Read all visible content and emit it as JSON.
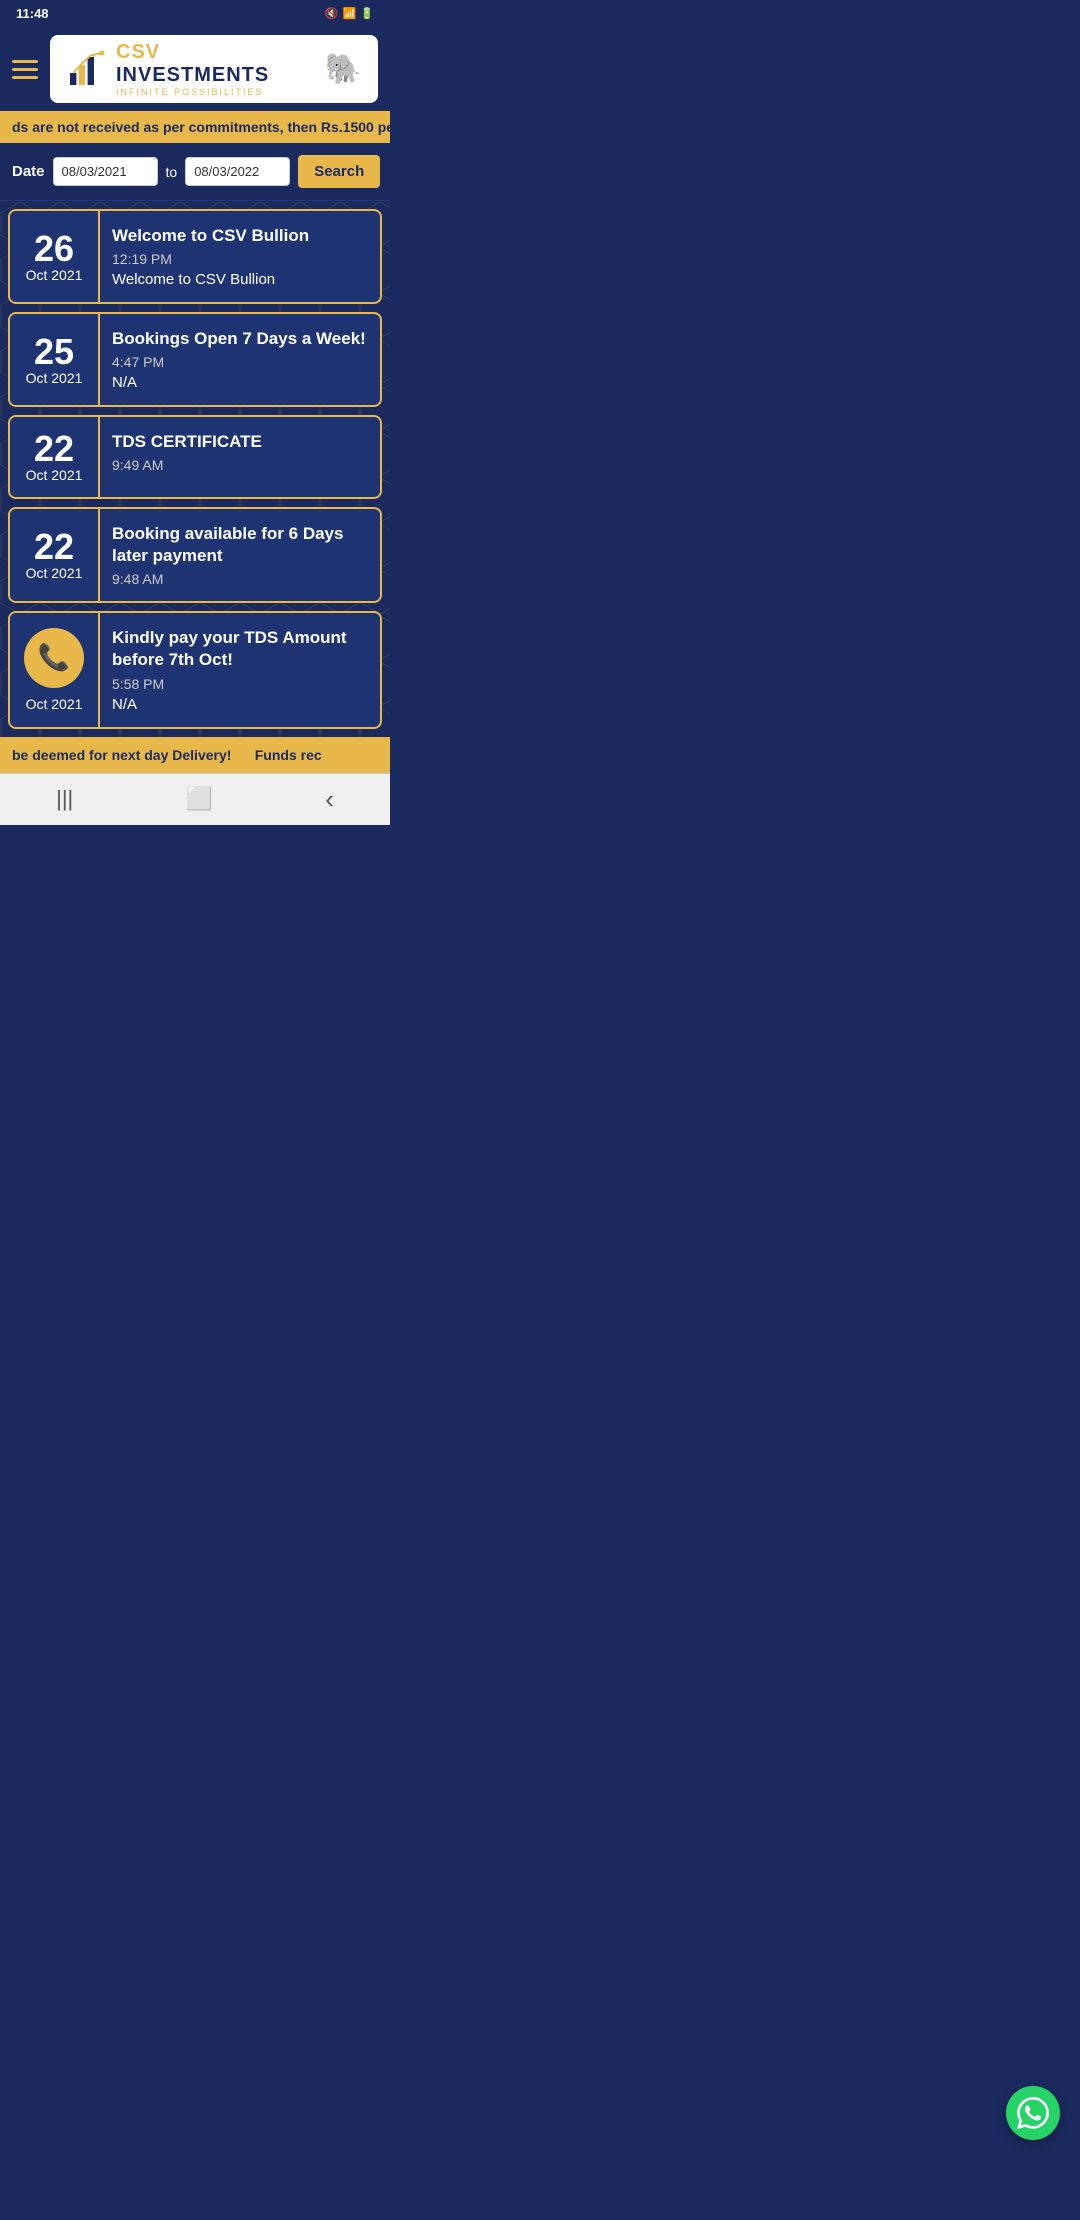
{
  "statusBar": {
    "time": "11:48",
    "icons": [
      "mute",
      "wifi",
      "signal",
      "battery"
    ]
  },
  "header": {
    "hamburgerLabel": "Menu",
    "logoTitle": "CSV INVESTMENTS",
    "logoSubtitle": "INFINITE POSSIBILITIES"
  },
  "ticker": {
    "text": "ds are not received as per commitments, then Rs.1500 pe"
  },
  "dateFilter": {
    "label": "Date",
    "fromDate": "08/03/2021",
    "toDate": "08/03/2022",
    "toLabel": "to",
    "searchLabel": "Search"
  },
  "cards": [
    {
      "day": "26",
      "month": "Oct 2021",
      "title": "Welcome to CSV Bullion",
      "time": "12:19 PM",
      "body": "Welcome to CSV Bullion",
      "hasPhone": false
    },
    {
      "day": "25",
      "month": "Oct 2021",
      "title": "Bookings Open 7 Days a Week!",
      "time": "4:47 PM",
      "body": "N/A",
      "hasPhone": false
    },
    {
      "day": "22",
      "month": "Oct 2021",
      "title": "TDS CERTIFICATE",
      "time": "9:49 AM",
      "body": "",
      "hasPhone": false
    },
    {
      "day": "22",
      "month": "Oct 2021",
      "title": "Booking available for 6 Days later payment",
      "time": "9:48 AM",
      "body": "",
      "hasPhone": false
    },
    {
      "day": "",
      "month": "Oct 2021",
      "title": "Kindly pay your TDS Amount before 7th Oct!",
      "time": "5:58 PM",
      "body": "N/A",
      "hasPhone": true
    }
  ],
  "bottomTicker": {
    "text": "be deemed for next day Delivery!    Funds rec"
  },
  "navBar": {
    "menu": "|||",
    "home": "⬜",
    "back": "‹"
  },
  "whatsapp": {
    "icon": "💬"
  }
}
